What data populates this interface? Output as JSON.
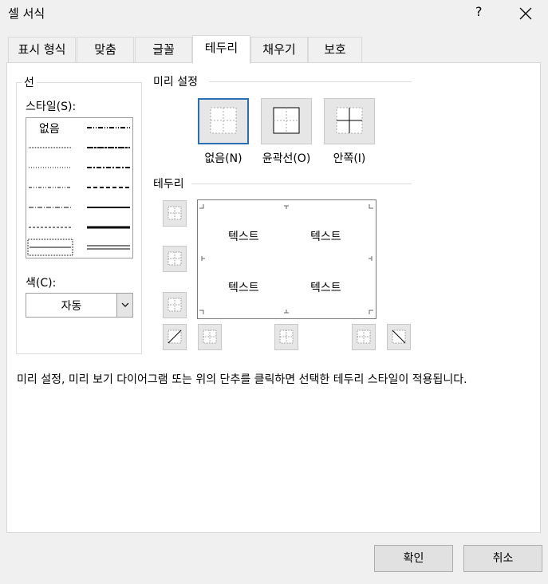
{
  "window": {
    "title": "셀 서식",
    "help": "?"
  },
  "tabs": [
    {
      "label": "표시 형식",
      "active": false
    },
    {
      "label": "맞춤",
      "active": false
    },
    {
      "label": "글꼴",
      "active": false
    },
    {
      "label": "테두리",
      "active": true
    },
    {
      "label": "채우기",
      "active": false
    },
    {
      "label": "보호",
      "active": false
    }
  ],
  "line": {
    "group_label": "선",
    "style_label": "스타일(S):",
    "style_none": "없음",
    "color_label": "색(C):",
    "color_value": "자동"
  },
  "presets": {
    "group_label": "미리 설정",
    "none": "없음(N)",
    "outline": "윤곽선(O)",
    "inside": "안쪽(I)"
  },
  "border": {
    "group_label": "테두리",
    "preview_text": [
      "텍스트",
      "텍스트",
      "텍스트",
      "텍스트"
    ]
  },
  "description": "미리 설정, 미리 보기 다이어그램 또는 위의 단추를 클릭하면 선택한 테두리 스타일이 적용됩니다.",
  "buttons": {
    "ok": "확인",
    "cancel": "취소"
  },
  "colors": {
    "selected_border": "#2a6fb5"
  }
}
